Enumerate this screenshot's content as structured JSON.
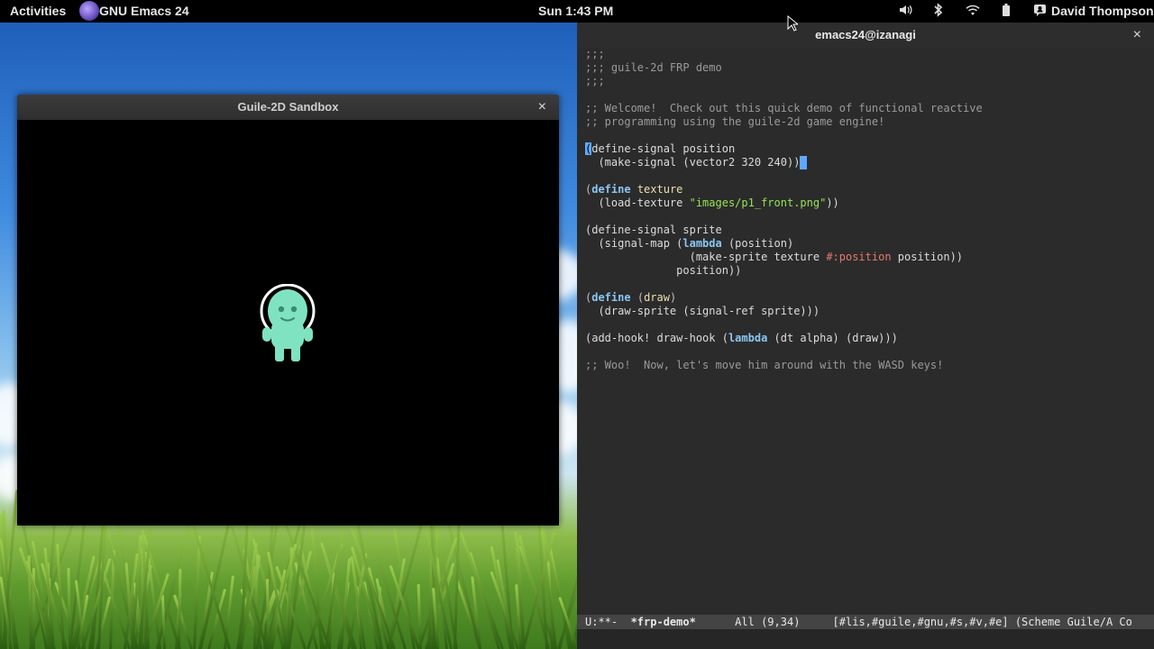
{
  "topbar": {
    "activities": "Activities",
    "app_name": "GNU Emacs 24",
    "clock": "Sun  1:43 PM",
    "user_name": "David Thompson",
    "icons": [
      "volume-icon",
      "bluetooth-icon",
      "wifi-icon",
      "battery-icon",
      "user-chat-icon"
    ]
  },
  "sandbox": {
    "title": "Guile-2D Sandbox",
    "close": "×"
  },
  "emacs": {
    "title": "emacs24@izanagi",
    "close": "×",
    "modeline": {
      "status": "U:**-  ",
      "buffer_name": "*frp-demo*",
      "position": "      All (9,34)     ",
      "minor_modes": "[#lis,#guile,#gnu,#s,#v,#e] (Scheme Guile/A Co"
    }
  },
  "colors": {
    "editor_bg": "#2b2b2b",
    "comment": "#9a9a9a",
    "keyword": "#8ac6f2",
    "string": "#95e454",
    "cursor": "#5fa8ff",
    "sprite": "#7fe3c1"
  }
}
